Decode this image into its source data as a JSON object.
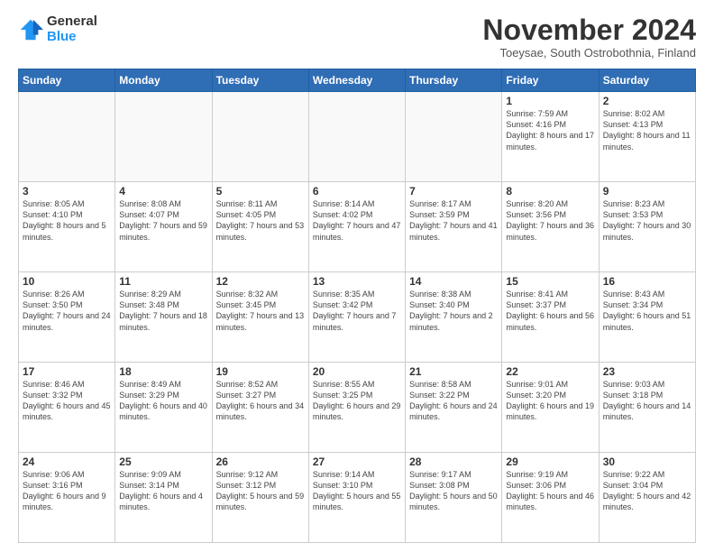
{
  "logo": {
    "general": "General",
    "blue": "Blue"
  },
  "title": "November 2024",
  "subtitle": "Toeysae, South Ostrobothnia, Finland",
  "headers": [
    "Sunday",
    "Monday",
    "Tuesday",
    "Wednesday",
    "Thursday",
    "Friday",
    "Saturday"
  ],
  "weeks": [
    [
      {
        "day": "",
        "info": ""
      },
      {
        "day": "",
        "info": ""
      },
      {
        "day": "",
        "info": ""
      },
      {
        "day": "",
        "info": ""
      },
      {
        "day": "",
        "info": ""
      },
      {
        "day": "1",
        "info": "Sunrise: 7:59 AM\nSunset: 4:16 PM\nDaylight: 8 hours\nand 17 minutes."
      },
      {
        "day": "2",
        "info": "Sunrise: 8:02 AM\nSunset: 4:13 PM\nDaylight: 8 hours\nand 11 minutes."
      }
    ],
    [
      {
        "day": "3",
        "info": "Sunrise: 8:05 AM\nSunset: 4:10 PM\nDaylight: 8 hours\nand 5 minutes."
      },
      {
        "day": "4",
        "info": "Sunrise: 8:08 AM\nSunset: 4:07 PM\nDaylight: 7 hours\nand 59 minutes."
      },
      {
        "day": "5",
        "info": "Sunrise: 8:11 AM\nSunset: 4:05 PM\nDaylight: 7 hours\nand 53 minutes."
      },
      {
        "day": "6",
        "info": "Sunrise: 8:14 AM\nSunset: 4:02 PM\nDaylight: 7 hours\nand 47 minutes."
      },
      {
        "day": "7",
        "info": "Sunrise: 8:17 AM\nSunset: 3:59 PM\nDaylight: 7 hours\nand 41 minutes."
      },
      {
        "day": "8",
        "info": "Sunrise: 8:20 AM\nSunset: 3:56 PM\nDaylight: 7 hours\nand 36 minutes."
      },
      {
        "day": "9",
        "info": "Sunrise: 8:23 AM\nSunset: 3:53 PM\nDaylight: 7 hours\nand 30 minutes."
      }
    ],
    [
      {
        "day": "10",
        "info": "Sunrise: 8:26 AM\nSunset: 3:50 PM\nDaylight: 7 hours\nand 24 minutes."
      },
      {
        "day": "11",
        "info": "Sunrise: 8:29 AM\nSunset: 3:48 PM\nDaylight: 7 hours\nand 18 minutes."
      },
      {
        "day": "12",
        "info": "Sunrise: 8:32 AM\nSunset: 3:45 PM\nDaylight: 7 hours\nand 13 minutes."
      },
      {
        "day": "13",
        "info": "Sunrise: 8:35 AM\nSunset: 3:42 PM\nDaylight: 7 hours\nand 7 minutes."
      },
      {
        "day": "14",
        "info": "Sunrise: 8:38 AM\nSunset: 3:40 PM\nDaylight: 7 hours\nand 2 minutes."
      },
      {
        "day": "15",
        "info": "Sunrise: 8:41 AM\nSunset: 3:37 PM\nDaylight: 6 hours\nand 56 minutes."
      },
      {
        "day": "16",
        "info": "Sunrise: 8:43 AM\nSunset: 3:34 PM\nDaylight: 6 hours\nand 51 minutes."
      }
    ],
    [
      {
        "day": "17",
        "info": "Sunrise: 8:46 AM\nSunset: 3:32 PM\nDaylight: 6 hours\nand 45 minutes."
      },
      {
        "day": "18",
        "info": "Sunrise: 8:49 AM\nSunset: 3:29 PM\nDaylight: 6 hours\nand 40 minutes."
      },
      {
        "day": "19",
        "info": "Sunrise: 8:52 AM\nSunset: 3:27 PM\nDaylight: 6 hours\nand 34 minutes."
      },
      {
        "day": "20",
        "info": "Sunrise: 8:55 AM\nSunset: 3:25 PM\nDaylight: 6 hours\nand 29 minutes."
      },
      {
        "day": "21",
        "info": "Sunrise: 8:58 AM\nSunset: 3:22 PM\nDaylight: 6 hours\nand 24 minutes."
      },
      {
        "day": "22",
        "info": "Sunrise: 9:01 AM\nSunset: 3:20 PM\nDaylight: 6 hours\nand 19 minutes."
      },
      {
        "day": "23",
        "info": "Sunrise: 9:03 AM\nSunset: 3:18 PM\nDaylight: 6 hours\nand 14 minutes."
      }
    ],
    [
      {
        "day": "24",
        "info": "Sunrise: 9:06 AM\nSunset: 3:16 PM\nDaylight: 6 hours\nand 9 minutes."
      },
      {
        "day": "25",
        "info": "Sunrise: 9:09 AM\nSunset: 3:14 PM\nDaylight: 6 hours\nand 4 minutes."
      },
      {
        "day": "26",
        "info": "Sunrise: 9:12 AM\nSunset: 3:12 PM\nDaylight: 5 hours\nand 59 minutes."
      },
      {
        "day": "27",
        "info": "Sunrise: 9:14 AM\nSunset: 3:10 PM\nDaylight: 5 hours\nand 55 minutes."
      },
      {
        "day": "28",
        "info": "Sunrise: 9:17 AM\nSunset: 3:08 PM\nDaylight: 5 hours\nand 50 minutes."
      },
      {
        "day": "29",
        "info": "Sunrise: 9:19 AM\nSunset: 3:06 PM\nDaylight: 5 hours\nand 46 minutes."
      },
      {
        "day": "30",
        "info": "Sunrise: 9:22 AM\nSunset: 3:04 PM\nDaylight: 5 hours\nand 42 minutes."
      }
    ]
  ]
}
